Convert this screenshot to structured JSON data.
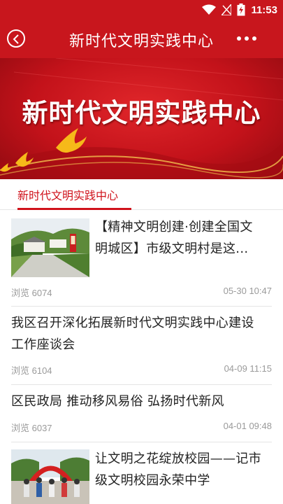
{
  "status_bar": {
    "time": "11:53",
    "icons": [
      "wifi-icon",
      "signal-icon",
      "battery-icon"
    ]
  },
  "app_bar": {
    "title": "新时代文明实践中心",
    "back_icon": "chevron-left-icon",
    "more_icon": "more-dots-icon"
  },
  "banner": {
    "title": "新时代文明实践中心"
  },
  "tabs": [
    {
      "label": "新时代文明实践中心",
      "active": true
    }
  ],
  "articles": [
    {
      "title_line1": "【精神文明创建·创建全国文",
      "title_line2": "明城区】市级文明村是这...",
      "views": "浏览 6074",
      "date": "05-30 10:47",
      "has_image": true
    },
    {
      "title_line1": "我区召开深化拓展新时代文明实践中心建设",
      "title_line2": "工作座谈会",
      "views": "浏览 6104",
      "date": "04-09 11:15",
      "has_image": false
    },
    {
      "title_line1": "区民政局 推动移风易俗 弘扬时代新风",
      "views": "浏览 6037",
      "date": "04-01 09:48",
      "has_image": false
    },
    {
      "title_line1": "让文明之花绽放校园——记市",
      "title_line2": "级文明校园永荣中学",
      "has_image": true
    }
  ],
  "colors": {
    "brand_red": "#c8161d",
    "tab_active": "#d0121b",
    "meta_gray": "#9a9a9a"
  }
}
